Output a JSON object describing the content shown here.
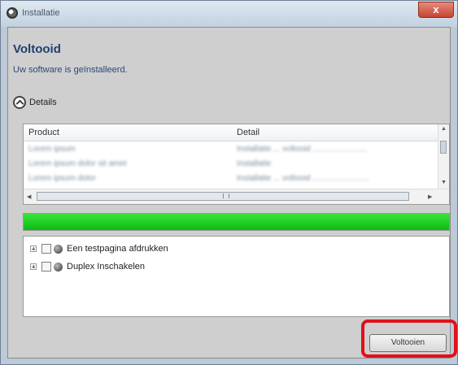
{
  "window": {
    "title": "Installatie",
    "close_label": "x"
  },
  "header": {
    "heading": "Voltooid",
    "subheading": "Uw software is geïnstalleerd."
  },
  "details": {
    "label": "Details"
  },
  "table": {
    "columns": [
      "Product",
      "Detail"
    ],
    "rows": [
      {
        "product": "Lorem ipsum",
        "detail": "Installatie ... voltooid ........................"
      },
      {
        "product": "Lorem ipsum dolor sit amet",
        "detail": "Installatie"
      },
      {
        "product": "Lorem ipsum dolor",
        "detail": "Installatie ... voltooid ........................."
      }
    ]
  },
  "progress": {
    "fraction": 1.0,
    "color": "#13c41a"
  },
  "options": [
    {
      "label": "Een testpagina afdrukken"
    },
    {
      "label": "Duplex Inschakelen"
    }
  ],
  "footer": {
    "finish_label": "Voltooien"
  },
  "colors": {
    "highlight": "#e0101a",
    "heading": "#1f3f6e"
  }
}
